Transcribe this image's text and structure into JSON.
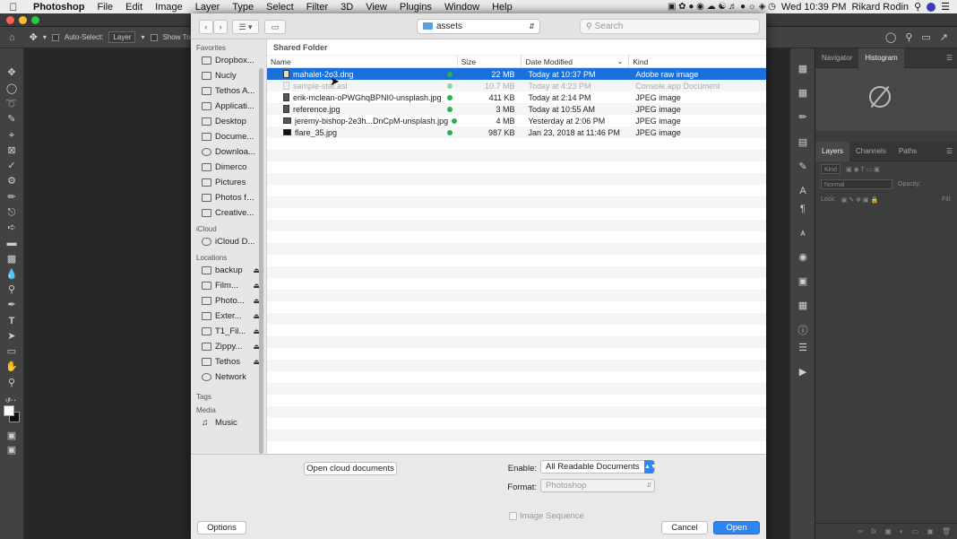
{
  "menubar": {
    "app": "Photoshop",
    "items": [
      "File",
      "Edit",
      "Image",
      "Layer",
      "Type",
      "Select",
      "Filter",
      "3D",
      "View",
      "Plugins",
      "Window",
      "Help"
    ],
    "clock": "Wed 10:39 PM",
    "user": "Rikard Rodin"
  },
  "options": {
    "auto_select": "Auto-Select:",
    "layer": "Layer",
    "show_transform": "Show Tran"
  },
  "panels": {
    "tabs1": [
      "Navigator",
      "Histogram"
    ],
    "tabs2": [
      "Layers",
      "Channels",
      "Paths"
    ],
    "kind": "Kind",
    "blend": "Normal",
    "opacity": "Opacity:",
    "lock": "Lock:",
    "fill": "Fill:"
  },
  "dialog": {
    "location": "assets",
    "search_placeholder": "Search",
    "folder_heading": "Shared Folder",
    "columns": {
      "name": "Name",
      "size": "Size",
      "date": "Date Modified",
      "kind": "Kind"
    },
    "files": [
      {
        "name": "mahalet-2o3.dng",
        "size": "22 MB",
        "date": "Today at 10:37 PM",
        "kind": "Adobe raw image"
      },
      {
        "name": "sample-stat.asl",
        "size": "10.7 MB",
        "date": "Today at 4:23 PM",
        "kind": "Console.app Document"
      },
      {
        "name": "erik-mclean-oPWGhqBPNI0-unsplash.jpg",
        "size": "411 KB",
        "date": "Today at 2:14 PM",
        "kind": "JPEG image"
      },
      {
        "name": "reference.jpg",
        "size": "3 MB",
        "date": "Today at 10:55 AM",
        "kind": "JPEG image"
      },
      {
        "name": "jeremy-bishop-2e3h...DnCpM-unsplash.jpg",
        "size": "4 MB",
        "date": "Yesterday at 2:06 PM",
        "kind": "JPEG image"
      },
      {
        "name": "flare_35.jpg",
        "size": "987 KB",
        "date": "Jan 23, 2018 at 11:46 PM",
        "kind": "JPEG image"
      }
    ],
    "sidebar": {
      "favorites_label": "Favorites",
      "favorites": [
        "Dropbox...",
        "Nucly",
        "Tethos A...",
        "Applicati...",
        "Desktop",
        "Docume...",
        "Downloa...",
        "Dimerco",
        "Pictures",
        "Photos fr...",
        "Creative..."
      ],
      "icloud_label": "iCloud",
      "icloud": [
        "iCloud D..."
      ],
      "locations_label": "Locations",
      "locations": [
        "backup",
        "Film...",
        "Photo...",
        "Exter...",
        "T1_Fil...",
        "Zippy...",
        "Tethos",
        "Network"
      ],
      "tags_label": "Tags",
      "media_label": "Media",
      "media": [
        "Music"
      ]
    },
    "footer": {
      "cloud_button": "Open cloud documents",
      "enable_label": "Enable:",
      "enable_value": "All Readable Documents",
      "format_label": "Format:",
      "format_value": "Photoshop",
      "sequence_label": "Image Sequence",
      "options_button": "Options",
      "cancel_button": "Cancel",
      "open_button": "Open"
    }
  },
  "colors": {
    "selection": "#1a6fd8",
    "primary": "#2f86f0",
    "ok": "#2cb24b"
  }
}
